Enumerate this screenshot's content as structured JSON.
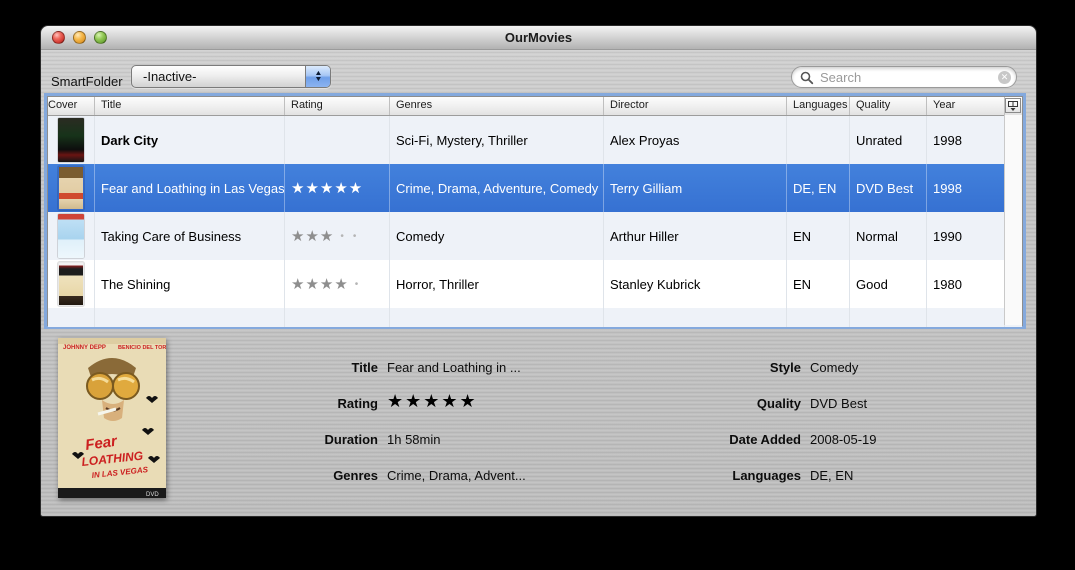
{
  "window": {
    "title": "OurMovies"
  },
  "toolbar": {
    "smartfolder_label": "SmartFolder",
    "smartfolder_value": "-Inactive-",
    "search_placeholder": "Search"
  },
  "table": {
    "columns": [
      "Cover",
      "Title",
      "Rating",
      "Genres",
      "Director",
      "Languages",
      "Quality",
      "Year"
    ],
    "rows": [
      {
        "title": "Dark City",
        "stars": "",
        "dots": "",
        "genres": "Sci-Fi, Mystery, Thriller",
        "director": "Alex Proyas",
        "languages": "",
        "quality": "Unrated",
        "year": "1998",
        "selected": false
      },
      {
        "title": "Fear and Loathing in Las Vegas",
        "stars": "★★★★★",
        "dots": "",
        "genres": "Crime, Drama, Adventure, Comedy",
        "director": "Terry Gilliam",
        "languages": "DE, EN",
        "quality": "DVD Best",
        "year": "1998",
        "selected": true
      },
      {
        "title": "Taking Care of Business",
        "stars": "★★★",
        "dots": "••",
        "genres": "Comedy",
        "director": "Arthur Hiller",
        "languages": "EN",
        "quality": "Normal",
        "year": "1990",
        "selected": false
      },
      {
        "title": "The Shining",
        "stars": "★★★★",
        "dots": "•",
        "genres": "Horror, Thriller",
        "director": "Stanley Kubrick",
        "languages": "EN",
        "quality": "Good",
        "year": "1980",
        "selected": false
      }
    ]
  },
  "details": {
    "left": [
      {
        "label": "Title",
        "value": "Fear and Loathing in ..."
      },
      {
        "label": "Rating",
        "value": "★★★★★"
      },
      {
        "label": "Duration",
        "value": "1h 58min"
      },
      {
        "label": "Genres",
        "value": "Crime, Drama, Advent..."
      }
    ],
    "right": [
      {
        "label": "Style",
        "value": "Comedy"
      },
      {
        "label": "Quality",
        "value": "DVD Best"
      },
      {
        "label": "Date Added",
        "value": "2008-05-19"
      },
      {
        "label": "Languages",
        "value": "DE, EN"
      }
    ]
  },
  "colors": {
    "selection": "#3875d7",
    "stripe": "#eef2f8"
  }
}
